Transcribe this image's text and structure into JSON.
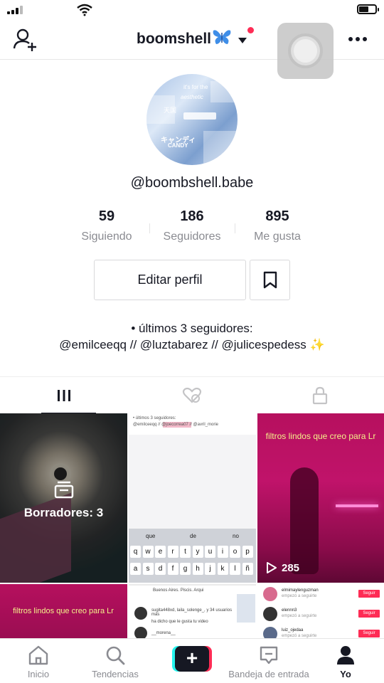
{
  "header": {
    "username": "boomshell",
    "username_emoji": "🦋"
  },
  "profile": {
    "handle": "@boombshell.babe",
    "avatar_texts": [
      "it's for the",
      "aesthetic",
      "天国",
      "キャンディ",
      "CANDY"
    ],
    "stats": [
      {
        "value": "59",
        "label": "Siguiendo"
      },
      {
        "value": "186",
        "label": "Seguidores"
      },
      {
        "value": "895",
        "label": "Me gusta"
      }
    ],
    "edit_button": "Editar perfil",
    "bio_line1": "• últimos 3 seguidores:",
    "bio_line2": "@emilceeqq // @luztabarez // @julicespedess",
    "bio_emoji": "✨"
  },
  "tabs": [
    {
      "name": "videos",
      "icon": "grid-bars-icon",
      "active": true
    },
    {
      "name": "liked",
      "icon": "heart-hidden-icon",
      "active": false
    },
    {
      "name": "private",
      "icon": "lock-icon",
      "active": false
    }
  ],
  "grid": {
    "drafts_label": "Borradores: 3",
    "video2": {
      "text_top": "• últimos 3 seguidores:",
      "text_mentions": "@emilceeqq // @joecorrea07 // @avril_morie",
      "predictions": [
        "que",
        "de",
        "no"
      ],
      "keys_row1": [
        "q",
        "w",
        "e",
        "r",
        "t",
        "y",
        "u",
        "i",
        "o",
        "p"
      ],
      "keys_row2": [
        "a",
        "s",
        "d",
        "f",
        "g",
        "h",
        "j",
        "k",
        "l",
        "ñ"
      ]
    },
    "video3": {
      "title": "filtros lindos que creo para Lr",
      "views": "285"
    },
    "video4": {
      "title": "filtros lindos que creo para Lr"
    },
    "video5": {
      "lines": [
        "Buenos Aires. Piscis. Arqui",
        "sugita448xd, laila_solenge_, y 34 usuarios más",
        "ha dicho que le gusta tu video",
        "__morena__"
      ]
    },
    "video6": {
      "users": [
        "elmimaylenguzman",
        "elennn3",
        "luiz_ojedaa"
      ],
      "sub": "empezó a seguirte",
      "button": "Seguir"
    }
  },
  "bottom_nav": [
    {
      "label": "Inicio",
      "icon": "home-icon"
    },
    {
      "label": "Tendencias",
      "icon": "search-icon"
    },
    {
      "label": "",
      "icon": "plus-icon"
    },
    {
      "label": "Bandeja de entrada",
      "icon": "inbox-icon"
    },
    {
      "label": "Yo",
      "icon": "profile-icon"
    }
  ],
  "colors": {
    "accent_red": "#fe2c55",
    "accent_cyan": "#25f4ee",
    "text_primary": "#161823",
    "text_secondary": "#8a8b91",
    "video_pink": "#b6105e",
    "title_yellow": "#f4f08a"
  }
}
